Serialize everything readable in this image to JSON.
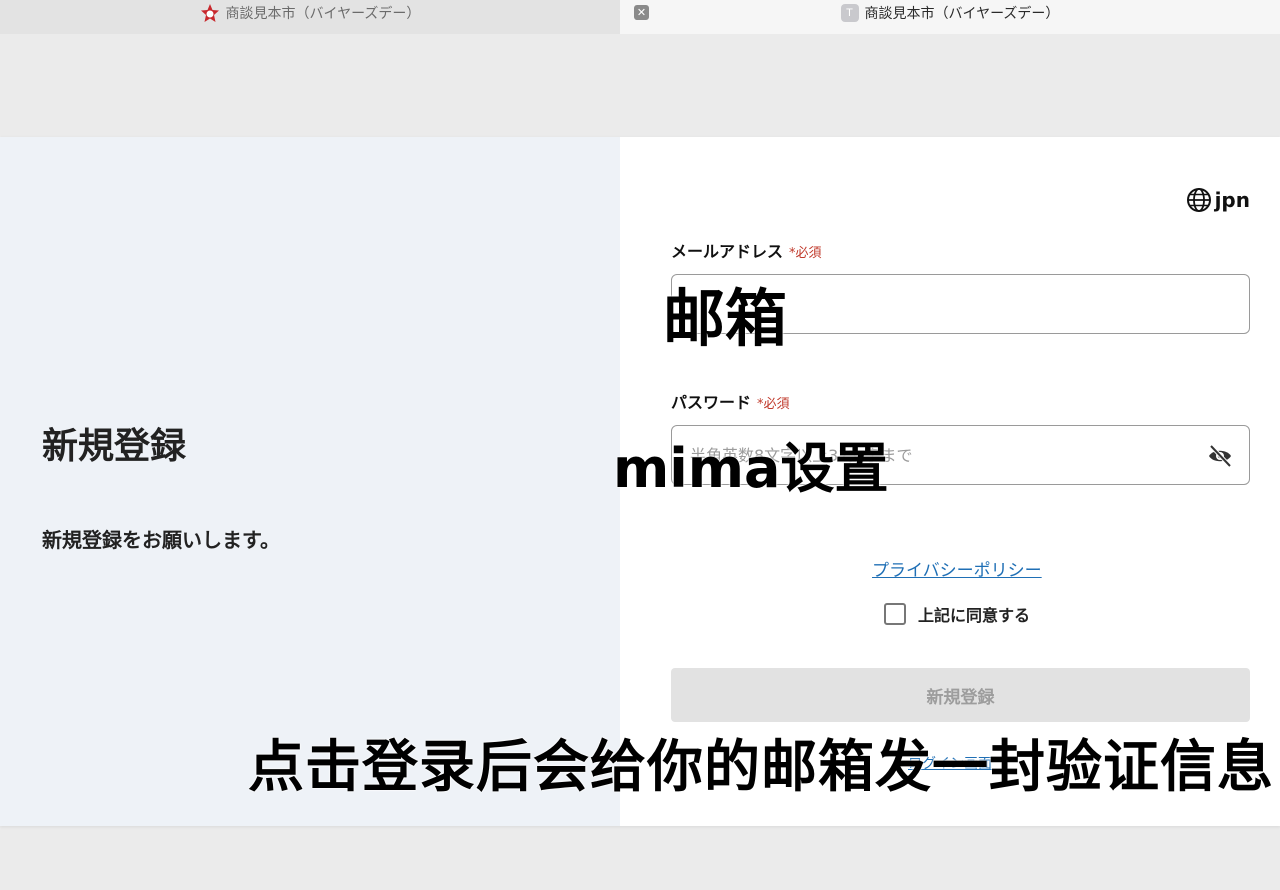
{
  "browser": {
    "tabs": [
      {
        "title": "商談見本市（バイヤーズデー）",
        "favicon": "fair-logo-icon",
        "active": false
      },
      {
        "title": "商談見本市（バイヤーズデー）",
        "favicon": "T",
        "active": true
      }
    ]
  },
  "left_panel": {
    "title": "新規登録",
    "subtitle": "新規登録をお願いします。"
  },
  "form": {
    "language": "jpn",
    "email": {
      "label": "メールアドレス",
      "required_mark": "*必須",
      "value": "",
      "placeholder": ""
    },
    "password": {
      "label": "パスワード",
      "required_mark": "*必須",
      "value": "",
      "placeholder": "半角英数8文字以上32文字まで"
    },
    "privacy_link": "プライバシーポリシー",
    "agree_label": "上記に同意する",
    "agree_checked": false,
    "submit_label": "新規登録",
    "login_link": "ログイン画面"
  },
  "overlay_captions": {
    "email_caption": "邮箱",
    "password_caption": "mima设置",
    "bottom_caption": "点击登录后会给你的邮箱发一封验证信息"
  },
  "colors": {
    "required": "#c0392b",
    "link": "#1f6fb5",
    "left_panel_bg": "#eef2f7",
    "submit_disabled_bg": "#e2e2e2"
  }
}
